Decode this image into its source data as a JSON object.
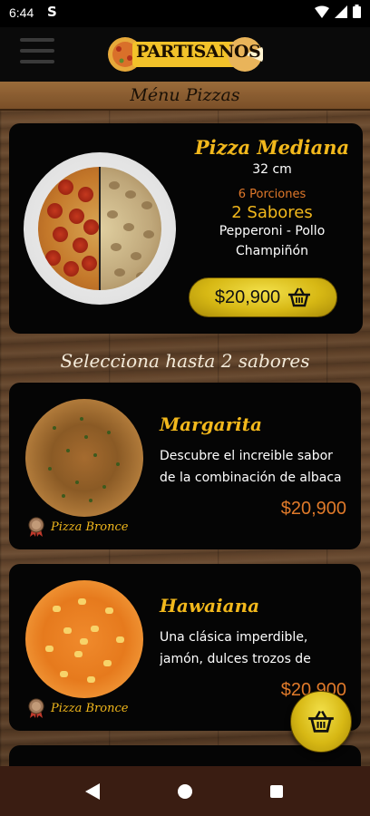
{
  "status_bar": {
    "time": "6:44",
    "app_icon_glyph": "S"
  },
  "header": {
    "logo_text": "PARTISANOS",
    "section_title": "Ménu Pizzas"
  },
  "featured": {
    "title": "Pizza Mediana",
    "size": "32 cm",
    "portions": "6 Porciones",
    "flavors": "2 Sabores",
    "flavor_line1": "Pepperoni - Pollo",
    "flavor_line2": "Champiñón",
    "price": "$20,900"
  },
  "subheading": "Selecciona hasta 2 sabores",
  "items": [
    {
      "name": "Margarita",
      "desc1": "Descubre el increible sabor",
      "desc2": "de la combinación de albaca",
      "price": "$20,900",
      "badge": "Pizza Bronce"
    },
    {
      "name": "Hawaiana",
      "desc1": "Una clásica imperdible,",
      "desc2": "jamón, dulces trozos de",
      "price": "$20,900",
      "badge": "Pizza Bronce"
    }
  ],
  "colors": {
    "accent": "#f2b81c",
    "price": "#e07a2a",
    "button_gold": "#d7b814",
    "navbar": "#3a1d12"
  }
}
